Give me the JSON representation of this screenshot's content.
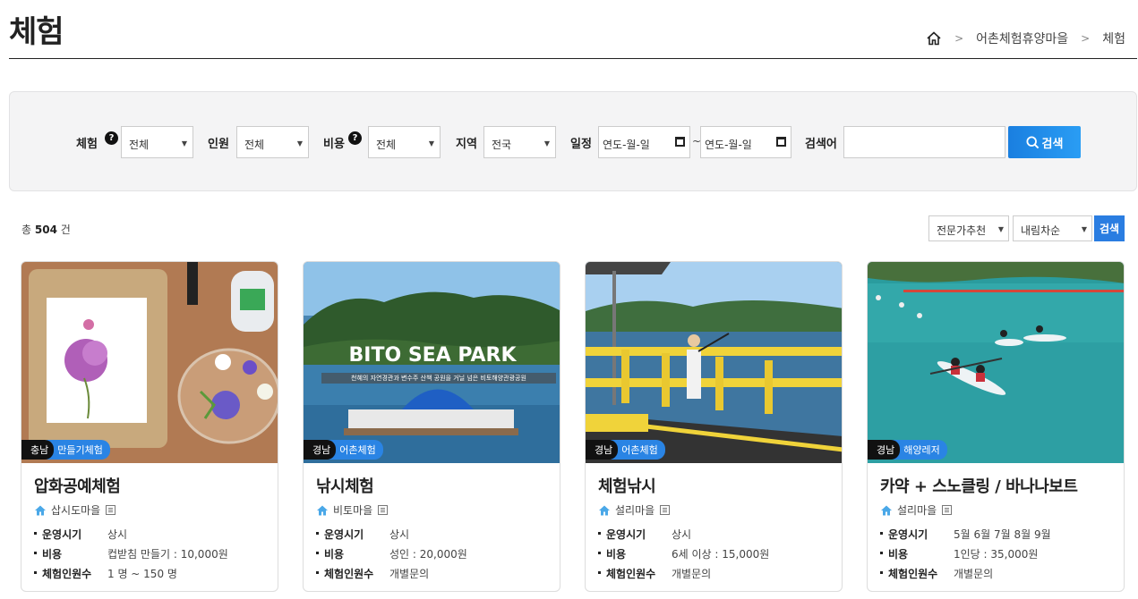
{
  "page": {
    "title": "체험",
    "breadcrumb": [
      "어촌체험휴양마을",
      "체험"
    ]
  },
  "search": {
    "experience_label": "체험",
    "experience_value": "전체",
    "people_label": "인원",
    "people_value": "전체",
    "cost_label": "비용",
    "cost_value": "전체",
    "region_label": "지역",
    "region_value": "전국",
    "schedule_label": "일정",
    "date_start_placeholder": "연도-월-일",
    "date_sep": "~",
    "date_end_placeholder": "연도-월-일",
    "keyword_label": "검색어",
    "keyword_value": "",
    "button_label": "검색",
    "help_glyph": "?"
  },
  "results": {
    "count_prefix": "총",
    "count": "504",
    "count_suffix": "건",
    "sort1": "전문가추천",
    "sort2": "내림차순",
    "sort_button": "검색"
  },
  "labels": {
    "period": "운영시기",
    "cost": "비용",
    "people": "체험인원수"
  },
  "cards": [
    {
      "region": "충남",
      "category": "만들기체험",
      "title": "압화공예체험",
      "village": "삽시도마을",
      "period": "상시",
      "cost": "컵받침 만들기 : 10,000원",
      "people": "1 명 ~ 150 명"
    },
    {
      "region": "경남",
      "category": "어촌체험",
      "title": "낚시체험",
      "village": "비토마을",
      "period": "상시",
      "cost": "성인 : 20,000원",
      "people": "개별문의",
      "image_text": "BITO SEA PARK",
      "image_subtext": "천혜의 자연경관과 변수주 산책 공원을 거닐 넘은 비토해양관광공원"
    },
    {
      "region": "경남",
      "category": "어촌체험",
      "title": "체험낚시",
      "village": "설리마을",
      "period": "상시",
      "cost": "6세 이상 : 15,000원",
      "people": "개별문의"
    },
    {
      "region": "경남",
      "category": "해양레저",
      "title": "카약 + 스노클링 / 바나나보트",
      "village": "설리마을",
      "period": "5월 6월 7월 8월 9월",
      "cost": "1인당 : 35,000원",
      "people": "개별문의"
    }
  ],
  "colors": {
    "accent": "#2a84e4",
    "search_button": "#1e88e5",
    "panel_bg": "#f4f4f5"
  }
}
